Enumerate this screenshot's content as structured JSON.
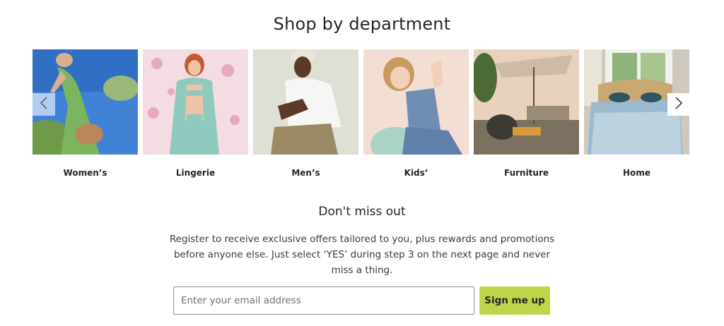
{
  "section": {
    "title": "Shop by department"
  },
  "departments": [
    {
      "label": "Women’s"
    },
    {
      "label": "Lingerie"
    },
    {
      "label": "Men’s"
    },
    {
      "label": "Kids’"
    },
    {
      "label": "Furniture"
    },
    {
      "label": "Home"
    }
  ],
  "carousel": {
    "prev_icon": "chevron-left-icon",
    "next_icon": "chevron-right-icon"
  },
  "newsletter": {
    "title": "Don't miss out",
    "text": "Register to receive exclusive offers tailored to you, plus rewards and promotions before anyone else. Just select ‘YES’ during step 3 on the next page and never miss a thing.",
    "email_placeholder": "Enter your email address",
    "email_value": "",
    "button_label": "Sign me up"
  },
  "colors": {
    "accent": "#bdd549",
    "text": "#262626"
  }
}
